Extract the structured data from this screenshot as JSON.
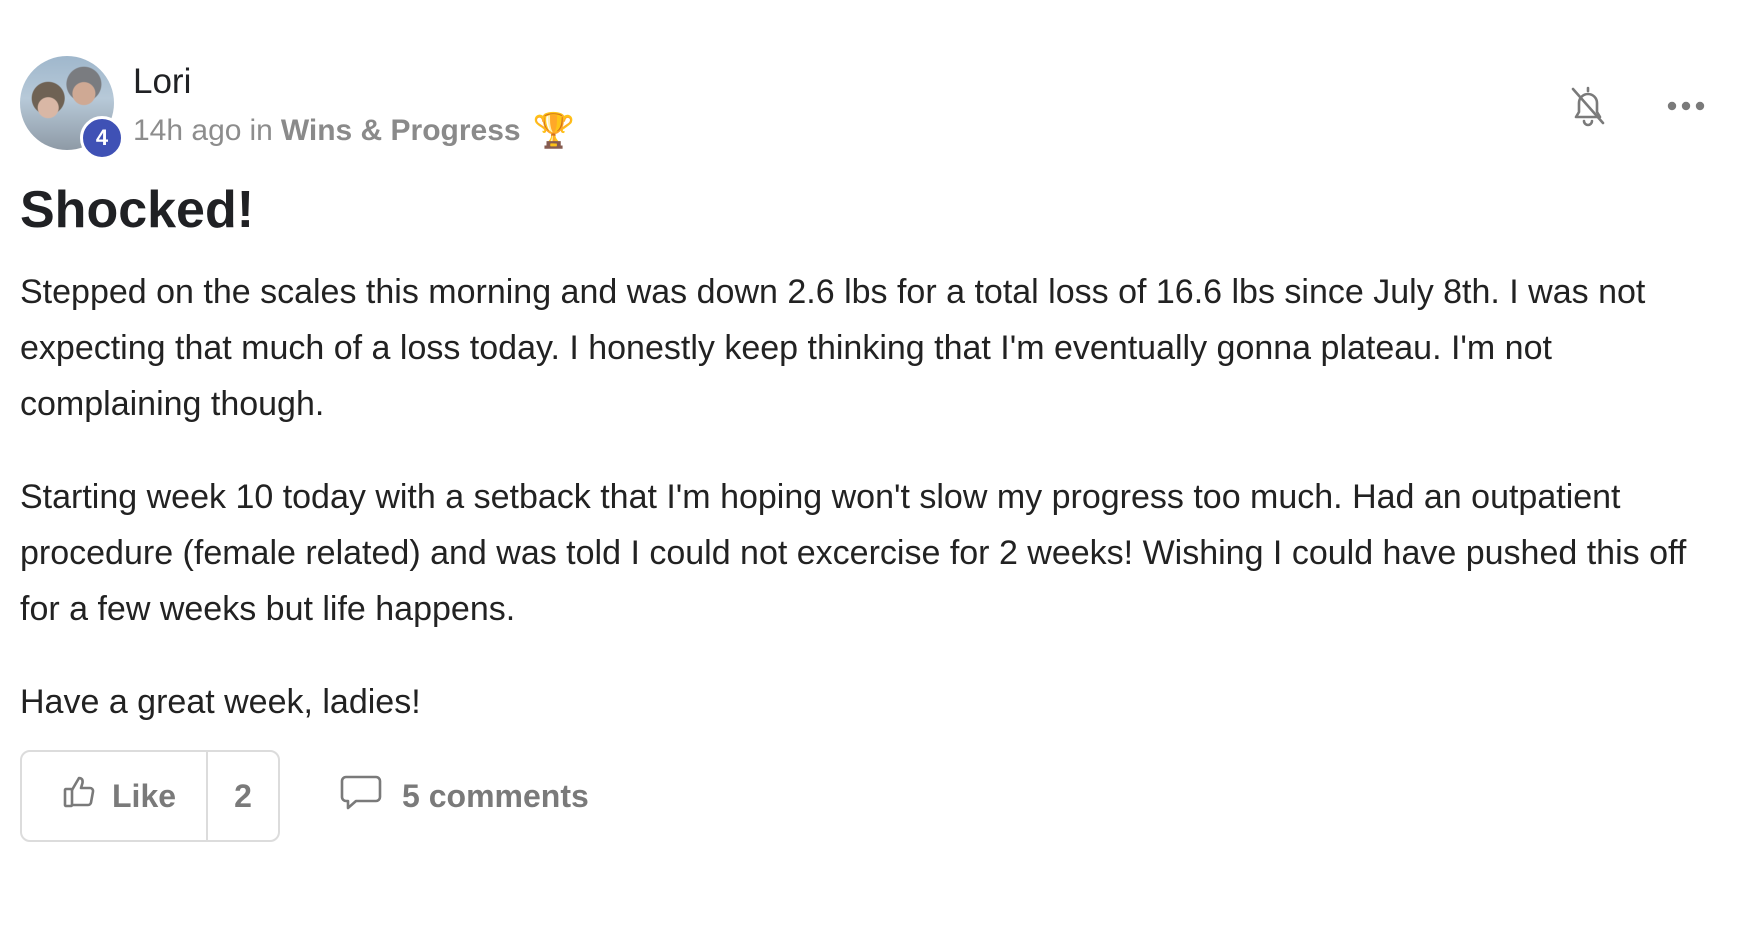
{
  "post": {
    "author": {
      "name": "Lori",
      "level": "4"
    },
    "meta": {
      "time_ago": "14h ago",
      "in_label": "in",
      "space_name": "Wins & Progress",
      "space_emoji": "🏆"
    },
    "title": "Shocked!",
    "paragraphs": [
      "Stepped on the scales this morning and was down 2.6 lbs for a total loss of 16.6 lbs since July 8th. I was not expecting that much of a loss today. I honestly keep thinking that I'm eventually gonna plateau. I'm not complaining though.",
      "Starting week 10 today with a setback that I'm hoping won't slow my progress too much. Had an outpatient procedure (female related) and was told I could not excercise for 2 weeks! Wishing I could have pushed this off for a few weeks but life happens.",
      "Have a great week, ladies!"
    ],
    "footer": {
      "like_label": "Like",
      "like_count": "2",
      "comments_label": "5 comments"
    }
  },
  "icons": {
    "notifications": "bell-off-icon",
    "more": "more-horizontal-icon",
    "like": "thumbs-up-icon",
    "comment": "comment-bubble-icon"
  },
  "colors": {
    "level_badge": "#3f51b5",
    "muted_text": "#8d8d8d",
    "border": "#dcdcdc"
  }
}
